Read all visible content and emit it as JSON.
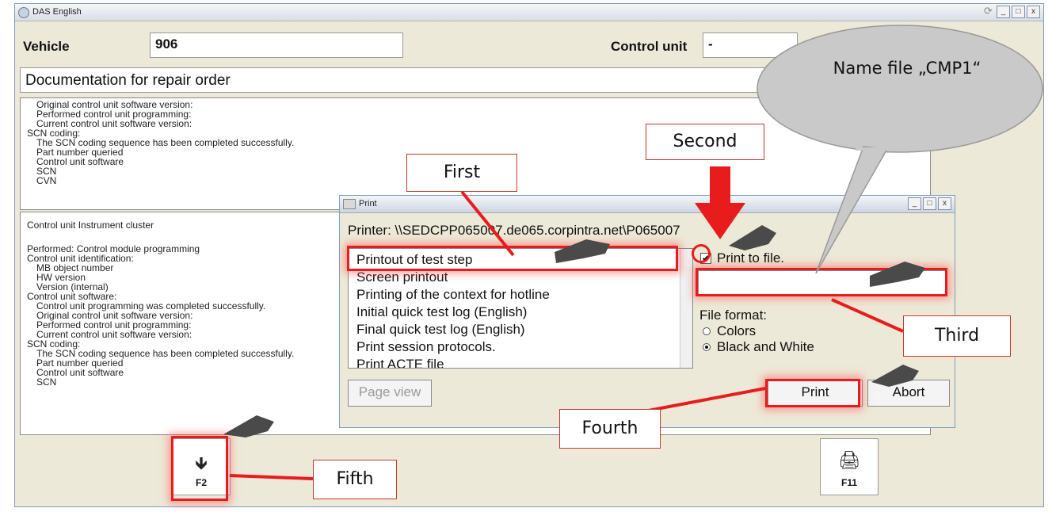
{
  "window": {
    "title": "DAS English",
    "controls": [
      "_",
      "□",
      "x"
    ]
  },
  "topbar": {
    "vehicle_label": "Vehicle",
    "vehicle_value": "906",
    "control_unit_label": "Control unit",
    "control_unit_value": "-"
  },
  "doc_title": "Documentation for repair order",
  "panel1_lines": [
    "Original control unit software version:",
    "Performed control unit programming:",
    "Current control unit software version:",
    "SCN coding:",
    "The SCN coding sequence has been completed successfully.",
    "Part number queried",
    "Control unit software",
    "SCN",
    "CVN"
  ],
  "panel2_lines": [
    "Control unit Instrument cluster",
    "",
    "Performed: Control module programming",
    "Control unit identification:",
    "MB object number",
    "HW version",
    "Version (internal)",
    "Control unit software:",
    "Control unit programming was completed successfully.",
    "Original control unit software version:",
    "Performed control unit programming:",
    "Current control unit software version:",
    "SCN coding:",
    "The SCN coding sequence has been completed successfully.",
    "Part number queried",
    "Control unit software",
    "SCN"
  ],
  "print_dialog": {
    "title": "Print",
    "printer": "Printer: \\\\SEDCPP065007.de065.corpintra.net\\P065007",
    "items": [
      "Printout of test step",
      "Screen printout",
      "Printing of the context for hotline",
      "Initial quick test log (English)",
      "Final quick test log (English)",
      "Print session protocols.",
      "Print ACTE file"
    ],
    "print_to_file_label": "Print to file.",
    "print_to_file_checked": "✔",
    "file_format_label": "File format:",
    "colors_label": "Colors",
    "bw_label": "Black and White",
    "page_view_label": "Page view",
    "print_label": "Print",
    "abort_label": "Abort"
  },
  "fkeys": {
    "f2_label": "F2",
    "f2_glyph": "🡻",
    "f11_label": "F11",
    "f11_glyph": "🖨"
  },
  "callouts": {
    "first": "First",
    "second": "Second",
    "third": "Third",
    "fourth": "Fourth",
    "fifth": "Fifth",
    "speech": "Name file „CMP1“"
  },
  "colors": {
    "highlight": "#e81c1c",
    "arrow": "#e81c1c",
    "bubble": "#c9c9c9"
  }
}
